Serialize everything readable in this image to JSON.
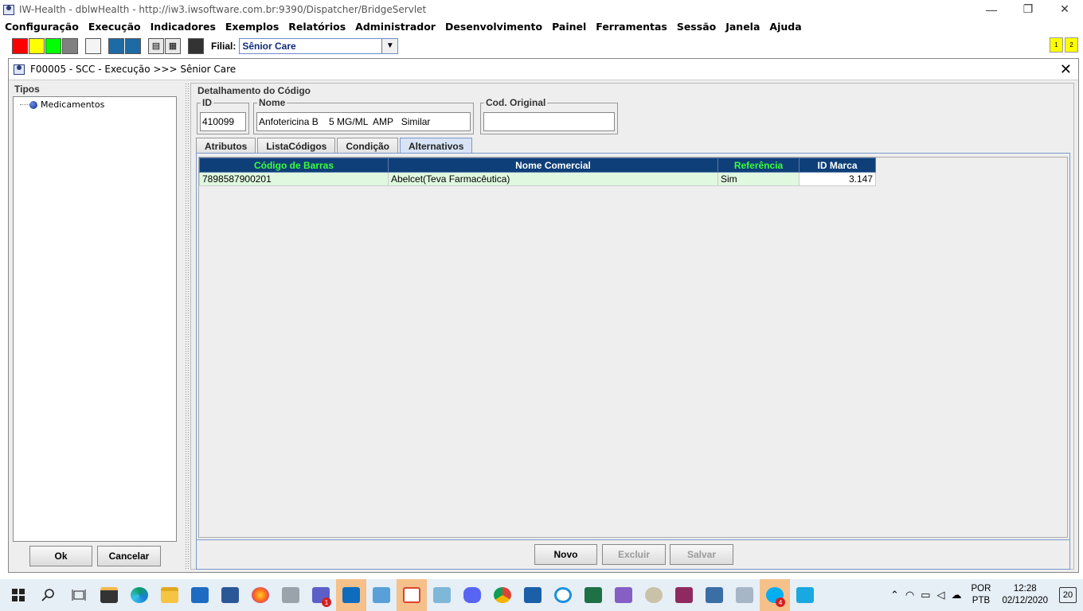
{
  "window": {
    "title": "IW-Health - dblwHealth - http://iw3.iwsoftware.com.br:9390/Dispatcher/BridgeServlet",
    "minimize": "—",
    "restore": "❐",
    "close": "✕"
  },
  "menu": [
    "Configuração",
    "Execução",
    "Indicadores",
    "Exemplos",
    "Relatórios",
    "Administrador",
    "Desenvolvimento",
    "Painel",
    "Ferramentas",
    "Sessão",
    "Janela",
    "Ajuda"
  ],
  "toolbar": {
    "color_buttons": [
      "#ff0000",
      "#ffff00",
      "#00ff00",
      "#808080",
      "#f4f4f4"
    ],
    "filial_label": "Filial:",
    "filial_value": "Sênior Care",
    "yellow_buttons": [
      "1",
      "2"
    ]
  },
  "internal_frame": {
    "title": "F00005 - SCC - Execução >>> Sênior Care",
    "close": "✕"
  },
  "left": {
    "group_title": "Tipos",
    "tree_items": [
      "Medicamentos"
    ],
    "ok_label": "Ok",
    "cancel_label": "Cancelar"
  },
  "detail": {
    "group_title": "Detalhamento do Código",
    "id_label": "ID",
    "id_value": "410099",
    "nome_label": "Nome",
    "nome_value": "Anfotericina B    5 MG/ML  AMP   Similar",
    "cod_original_label": "Cod. Original",
    "cod_original_value": ""
  },
  "tabs": [
    {
      "label": "Atributos",
      "active": false
    },
    {
      "label": "ListaCódigos",
      "active": false
    },
    {
      "label": "Condição",
      "active": false
    },
    {
      "label": "Alternativos",
      "active": true
    }
  ],
  "grid": {
    "columns": [
      "Código de Barras",
      "Nome Comercial",
      "Referência",
      "ID Marca"
    ],
    "rows": [
      [
        "7898587900201",
        "Abelcet(Teva Farmacêutica)",
        "Sim",
        "3.147"
      ]
    ]
  },
  "actions": {
    "novo": "Novo",
    "excluir": "Excluir",
    "salvar": "Salvar"
  },
  "taskbar": {
    "ime_line1": "POR",
    "ime_line2": "PTB",
    "time": "12:28",
    "date": "02/12/2020",
    "notifications": "20",
    "teams_badge": "1",
    "skype_badge": "4"
  }
}
